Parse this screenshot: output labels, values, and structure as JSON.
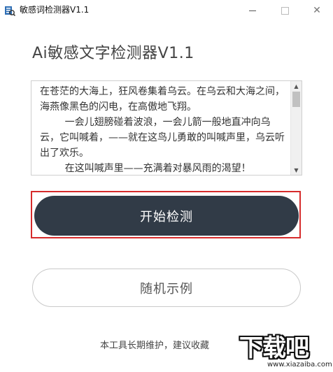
{
  "window": {
    "title": "敏感词检测器V1.1",
    "minimize_icon": "minimize-icon",
    "maximize_icon": "maximize-icon",
    "close_glyph": "✕"
  },
  "main": {
    "heading": "Ai敏感文字检测器V1.1",
    "input_text": "在苍茫的大海上，狂风卷集着乌云。在乌云和大海之间，海燕像黑色的闪电，在高傲地飞翔。\n        一会儿翅膀碰着波浪，一会儿箭一般地直冲向乌云，它叫喊着，——就在这鸟儿勇敢的叫喊声里，乌云听出了欢乐。\n        在这叫喊声里——充满着对暴风雨的渴望！",
    "detect_button": "开始检测",
    "random_button": "随机示例"
  },
  "footer": {
    "text": "本工具长期维护，建议收藏"
  },
  "watermark": {
    "brand": "下载吧",
    "url": "www.xiazaiba.com"
  },
  "colors": {
    "primary_button": "#313b47",
    "highlight_border": "#d62b2b"
  }
}
